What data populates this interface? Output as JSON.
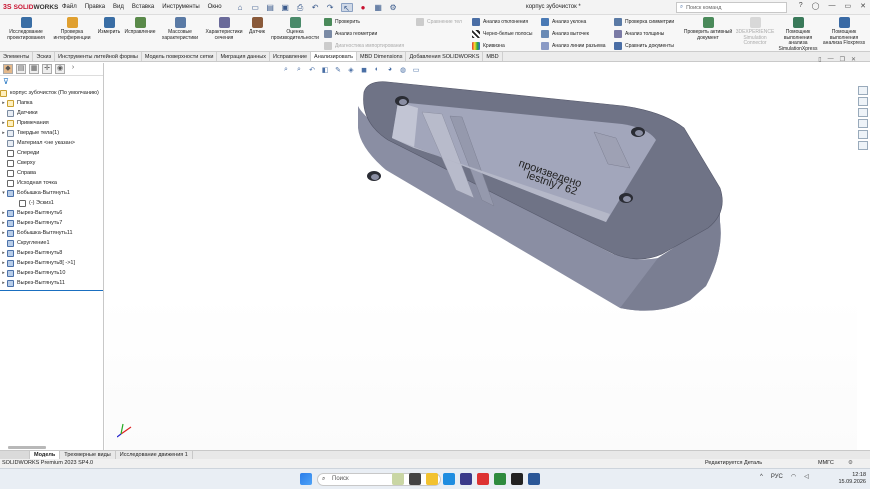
{
  "app": {
    "brand_ds": "3S",
    "brand_solid": "SOLID",
    "brand_works": "WORKS",
    "doc_title": "корпус зубочисток *",
    "search_placeholder": "Поиск команд",
    "menu": [
      "Файл",
      "Правка",
      "Вид",
      "Вставка",
      "Инструменты",
      "Окно"
    ]
  },
  "ribbon": {
    "big_buttons": [
      {
        "label": "Исследование проектирования",
        "icon": "study-icon",
        "color": "#3a6ea5"
      },
      {
        "label": "Проверка интерференции",
        "icon": "interference-icon",
        "color": "#e0a030"
      },
      {
        "label": "Измерить",
        "icon": "measure-icon",
        "color": "#3a6ea5"
      },
      {
        "label": "Исправление",
        "icon": "repair-icon",
        "color": "#5a8a4a"
      },
      {
        "label": "Массовые характеристики",
        "icon": "mass-props-icon",
        "color": "#5a7aa5"
      },
      {
        "label": "Характеристики сечения",
        "icon": "section-props-icon",
        "color": "#6a6a9a"
      },
      {
        "label": "Датчик",
        "icon": "sensor-icon",
        "color": "#8a5a3a"
      },
      {
        "label": "Оценка производительности",
        "icon": "performance-icon",
        "color": "#4a8a6a"
      }
    ],
    "mid_col1": [
      "Проверить",
      "Анализ геометрии",
      "Диагностика импортирования"
    ],
    "mid_col1_disabled": "Сравнение тел",
    "mid_col2": [
      "Анализ отклонения",
      "Черно-белые полосы",
      "Кривизна"
    ],
    "mid_col3": [
      "Анализ уклона",
      "Анализ выточек",
      "Анализ линии разъема"
    ],
    "mid_col4": [
      "Проверка симметрии",
      "Анализ толщины",
      "Сравнить документы"
    ],
    "right_buttons": [
      {
        "label": "Проверить активный документ",
        "disabled": false
      },
      {
        "label": "3DEXPERIENCE Simulation Connector",
        "disabled": true
      },
      {
        "label": "Помощник выполнения анализа SimulationXpress",
        "disabled": false
      },
      {
        "label": "Помощник выполнения анализа Floxpress",
        "disabled": false
      }
    ]
  },
  "tabs": [
    "Элементы",
    "Эскиз",
    "Инструменты литейной формы",
    "Модель поверхности сетки",
    "Миграция данных",
    "Исправление",
    "Анализировать",
    "MBD Dimensions",
    "Добавления SOLIDWORKS",
    "MBD"
  ],
  "active_tab": "Анализировать",
  "tree": {
    "root": "корпус зубочисток (По умолчанию)",
    "items": [
      {
        "label": "Папка",
        "arrow": "▸",
        "icon": "folder"
      },
      {
        "label": "Датчики",
        "arrow": "",
        "icon": "sensor"
      },
      {
        "label": "Примечания",
        "arrow": "▸",
        "icon": "annotation"
      },
      {
        "label": "Твердые тела(1)",
        "arrow": "▸",
        "icon": "solid"
      },
      {
        "label": "Материал <не указан>",
        "arrow": "",
        "icon": "material"
      },
      {
        "label": "Спереди",
        "arrow": "",
        "icon": "plane"
      },
      {
        "label": "Сверху",
        "arrow": "",
        "icon": "plane"
      },
      {
        "label": "Справа",
        "arrow": "",
        "icon": "plane"
      },
      {
        "label": "Исходная точка",
        "arrow": "",
        "icon": "origin"
      },
      {
        "label": "Бобышка-Вытянуть1",
        "arrow": "▾",
        "icon": "feature"
      },
      {
        "label": "(-) Эскиз1",
        "arrow": "",
        "icon": "sketch",
        "indent": true
      },
      {
        "label": "Вырез-Вытянуть6",
        "arrow": "▸",
        "icon": "feature"
      },
      {
        "label": "Вырез-Вытянуть7",
        "arrow": "▸",
        "icon": "feature"
      },
      {
        "label": "Бобышка-Вытянуть11",
        "arrow": "▸",
        "icon": "feature"
      },
      {
        "label": "Скругление1",
        "arrow": "",
        "icon": "feature"
      },
      {
        "label": "Вырез-Вытянуть8",
        "arrow": "▸",
        "icon": "feature"
      },
      {
        "label": "Вырез-Вытянуть8[ ->1]",
        "arrow": "▸",
        "icon": "feature"
      },
      {
        "label": "Вырез-Вытянуть10",
        "arrow": "▸",
        "icon": "feature"
      },
      {
        "label": "Вырез-Вытянуть11",
        "arrow": "▸",
        "icon": "feature"
      }
    ]
  },
  "model_text": {
    "line1": "произведено",
    "line2": "lestnly7 62"
  },
  "bottom_tabs": [
    "Модель",
    "Трехмерные виды",
    "Исследование движения 1"
  ],
  "status": {
    "version": "SOLIDWORKS Premium 2023 SP4.0",
    "mode": "Редактируется Деталь",
    "units": "ММГС"
  },
  "taskbar": {
    "search": "Поиск",
    "lang": "РУС",
    "time": "12:18",
    "date": "15.09.2026"
  },
  "colors": {
    "accent": "#c8102e",
    "tab_active_bg": "#ffffff",
    "model_face": "#8c90a6",
    "model_dark": "#6c6f82"
  }
}
